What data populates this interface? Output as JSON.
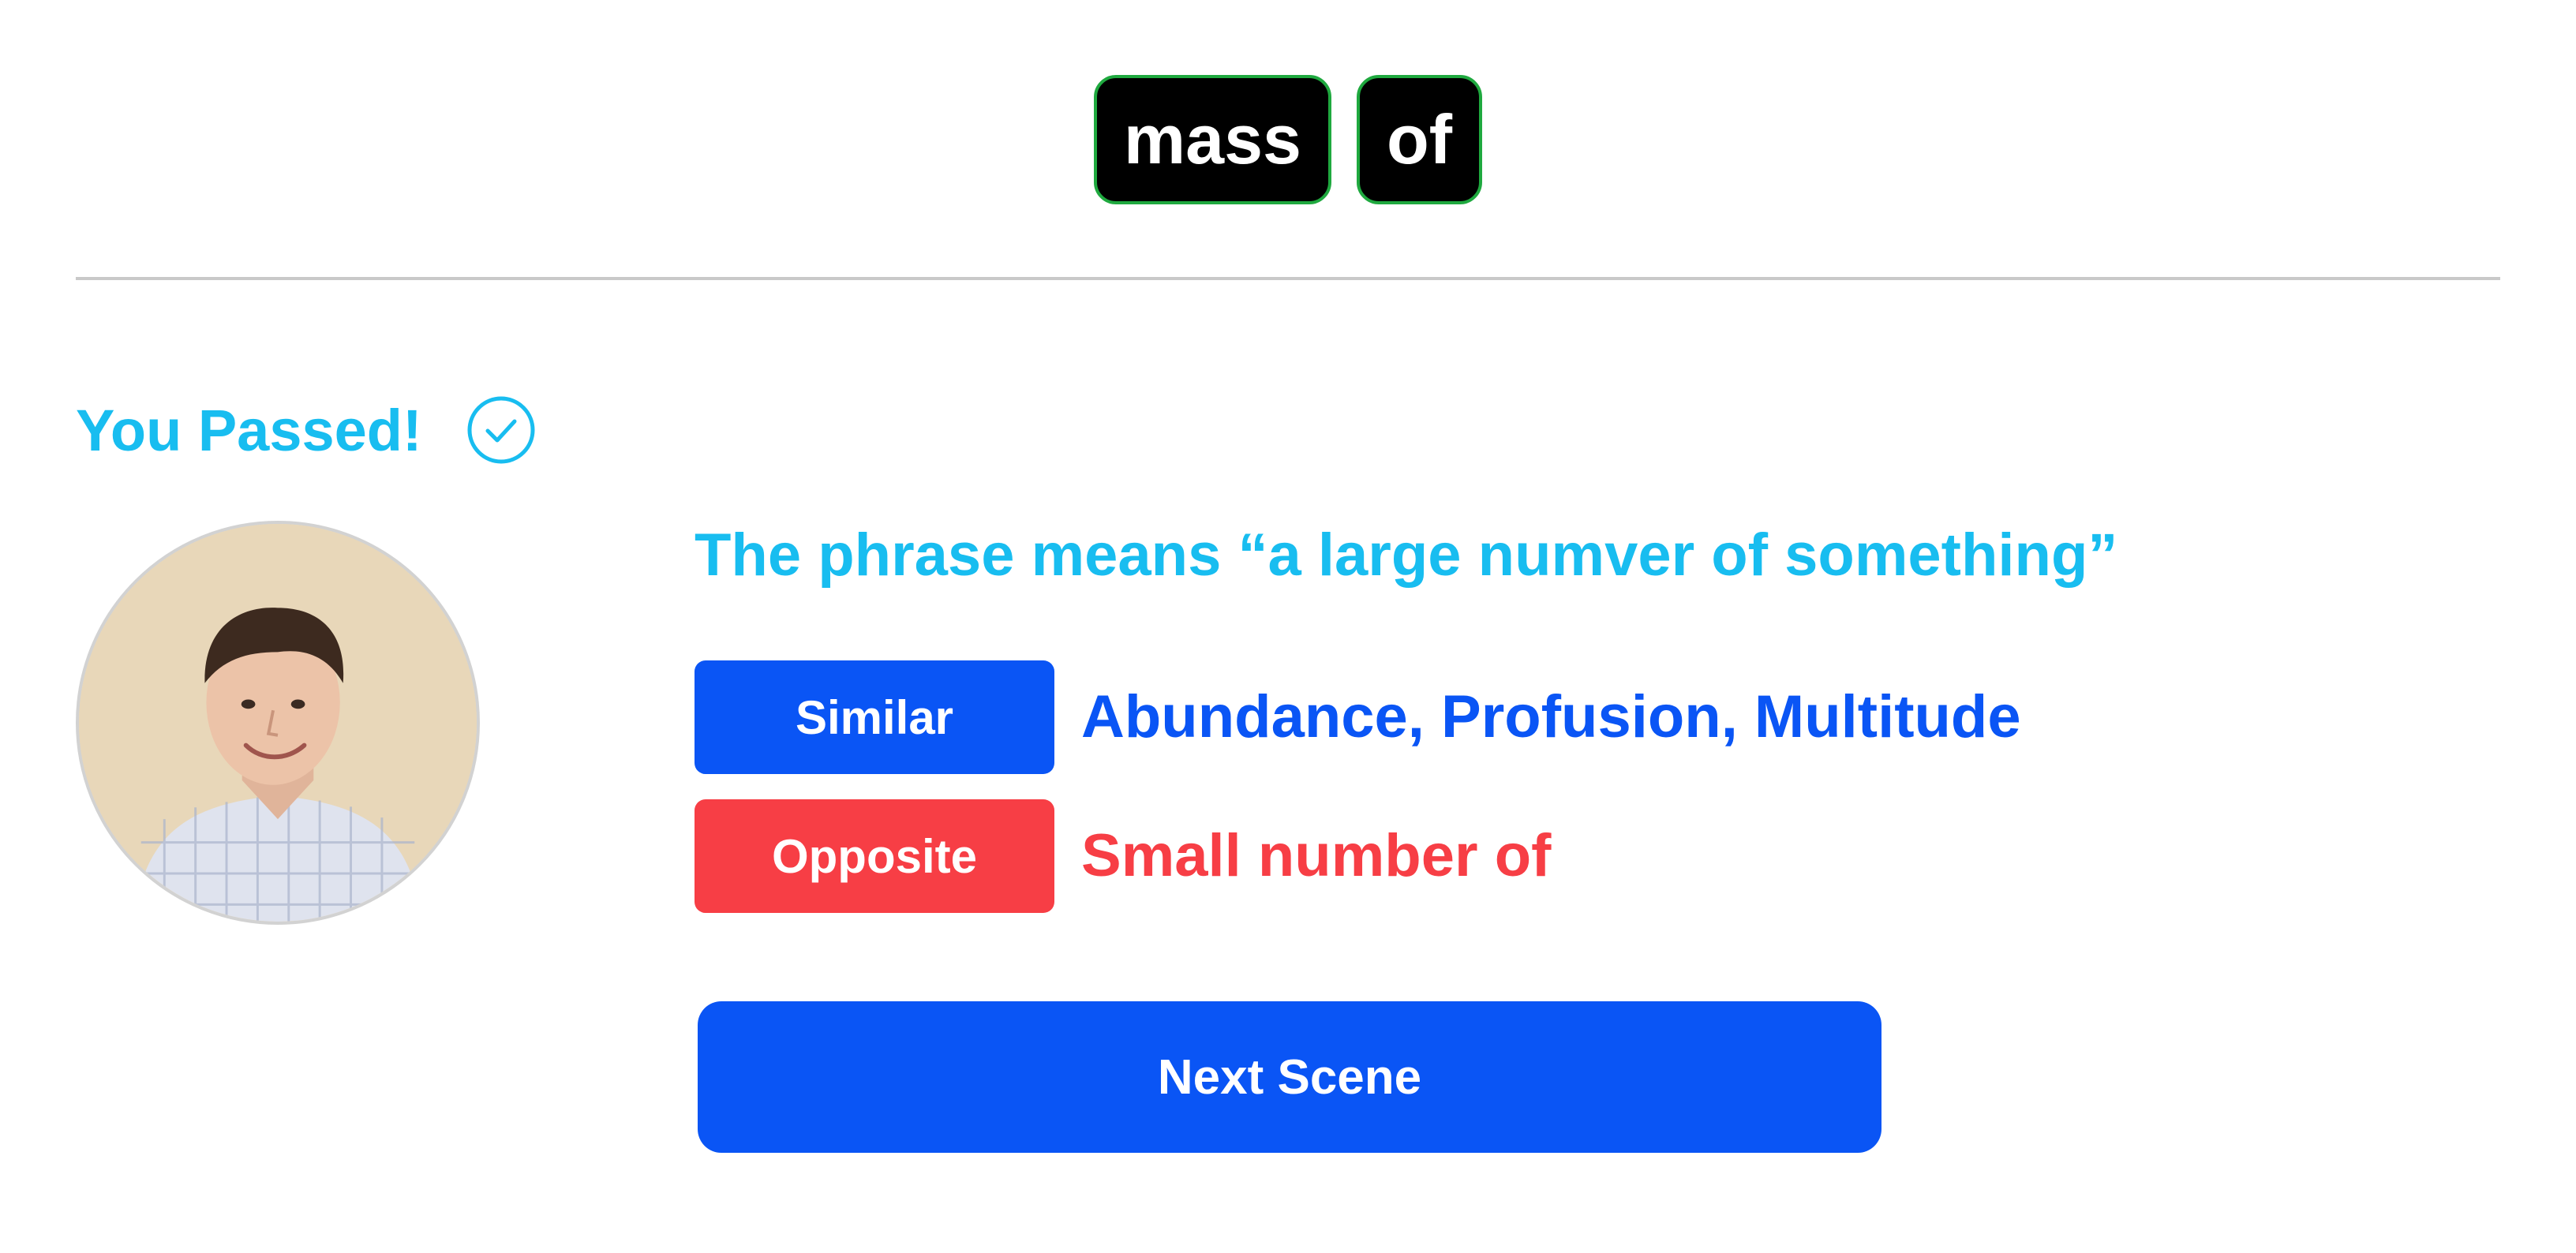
{
  "tiles": [
    {
      "word": "mass"
    },
    {
      "word": "of"
    }
  ],
  "result": {
    "text": "You Passed!",
    "icon": "check-circle-icon"
  },
  "avatar": {
    "icon": "profile-photo"
  },
  "meaning": {
    "text": "The phrase means “a large numver of something”"
  },
  "similar": {
    "label": "Similar",
    "words": "Abundance, Profusion, Multitude"
  },
  "opposite": {
    "label": "Opposite",
    "words": "Small number of"
  },
  "next_button": {
    "label": "Next Scene"
  },
  "colors": {
    "accent_blue": "#0a55f5",
    "success_cyan": "#18bdf0",
    "opposite_red": "#f73e45",
    "tile_border_green": "#1fa93f"
  }
}
